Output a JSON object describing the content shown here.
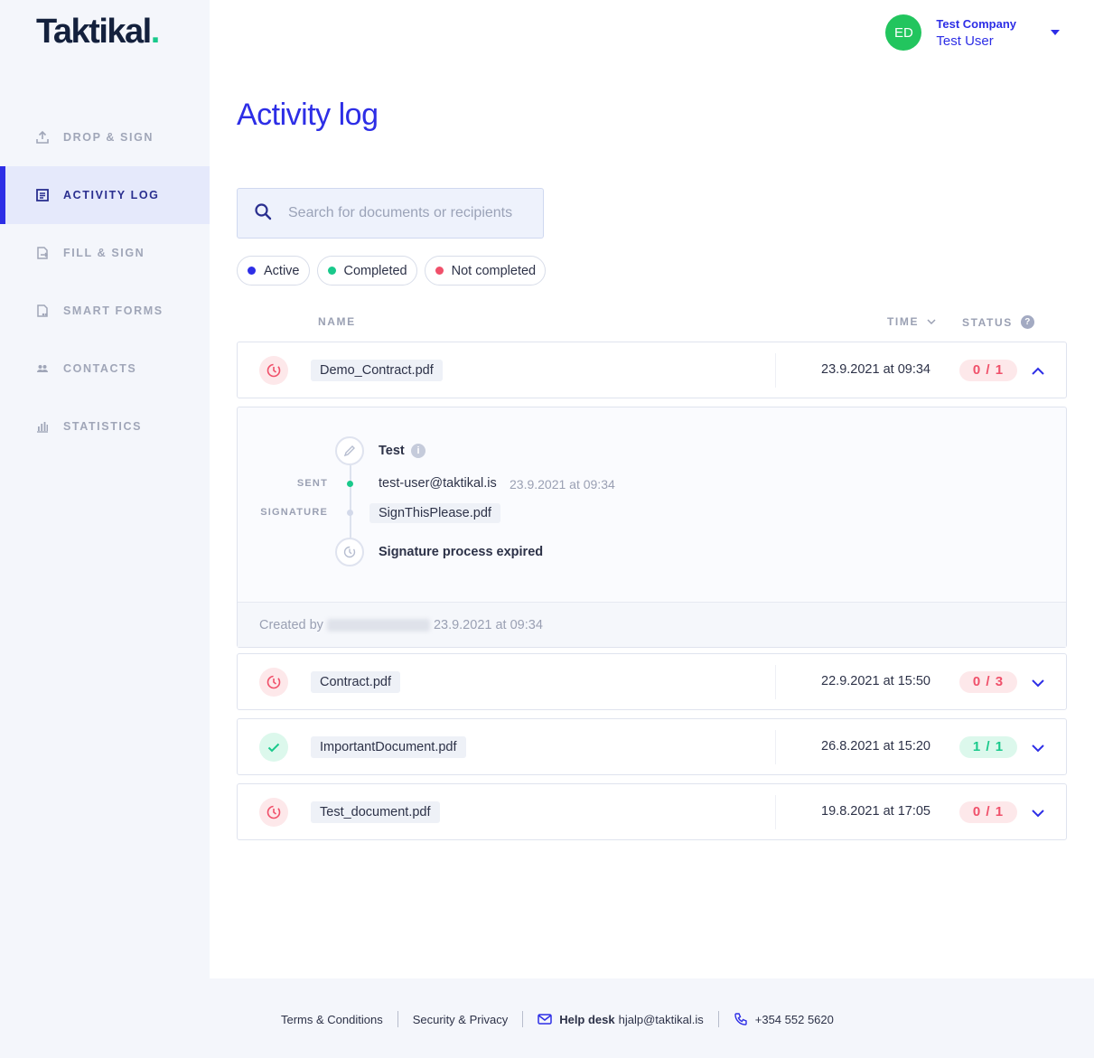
{
  "brand": {
    "name": "Taktikal",
    "dot": "."
  },
  "user": {
    "initials": "ED",
    "company": "Test Company",
    "name": "Test User",
    "avatar_color": "#22c55e"
  },
  "nav": {
    "items": [
      {
        "label": "DROP & SIGN",
        "icon": "upload-icon",
        "active": false
      },
      {
        "label": "ACTIVITY LOG",
        "icon": "activity-log-icon",
        "active": true
      },
      {
        "label": "FILL & SIGN",
        "icon": "fill-sign-icon",
        "active": false
      },
      {
        "label": "SMART FORMS",
        "icon": "smart-forms-icon",
        "active": false
      },
      {
        "label": "CONTACTS",
        "icon": "contacts-icon",
        "active": false
      },
      {
        "label": "STATISTICS",
        "icon": "statistics-icon",
        "active": false
      }
    ]
  },
  "page": {
    "title": "Activity log"
  },
  "search": {
    "placeholder": "Search for documents or recipients",
    "value": ""
  },
  "filters": [
    {
      "label": "Active",
      "color": "#2d2ee6"
    },
    {
      "label": "Completed",
      "color": "#19c98b"
    },
    {
      "label": "Not completed",
      "color": "#f0506a"
    }
  ],
  "columns": {
    "name": "NAME",
    "time": "TIME",
    "status": "STATUS"
  },
  "documents": [
    {
      "name": "Demo_Contract.pdf",
      "time": "23.9.2021 at 09:34",
      "status": "0 / 1",
      "state": "expired",
      "expanded": true
    },
    {
      "name": "Contract.pdf",
      "time": "22.9.2021 at 15:50",
      "status": "0 / 3",
      "state": "expired",
      "expanded": false
    },
    {
      "name": "ImportantDocument.pdf",
      "time": "26.8.2021 at 15:20",
      "status": "1 / 1",
      "state": "completed",
      "expanded": false
    },
    {
      "name": "Test_document.pdf",
      "time": "19.8.2021 at 17:05",
      "status": "0 / 1",
      "state": "expired",
      "expanded": false
    }
  ],
  "detail": {
    "recipient_name": "Test",
    "sent_label": "SENT",
    "signature_label": "SIGNATURE",
    "email": "test-user@taktikal.is",
    "sent_time": "23.9.2021 at 09:34",
    "signature_file": "SignThisPlease.pdf",
    "expired_text": "Signature process expired",
    "created_by_label": "Created by",
    "created_time": "23.9.2021 at 09:34"
  },
  "footer": {
    "terms": "Terms & Conditions",
    "security": "Security & Privacy",
    "helpdesk_label": "Help desk",
    "helpdesk_email": "hjalp@taktikal.is",
    "phone": "+354 552 5620"
  }
}
